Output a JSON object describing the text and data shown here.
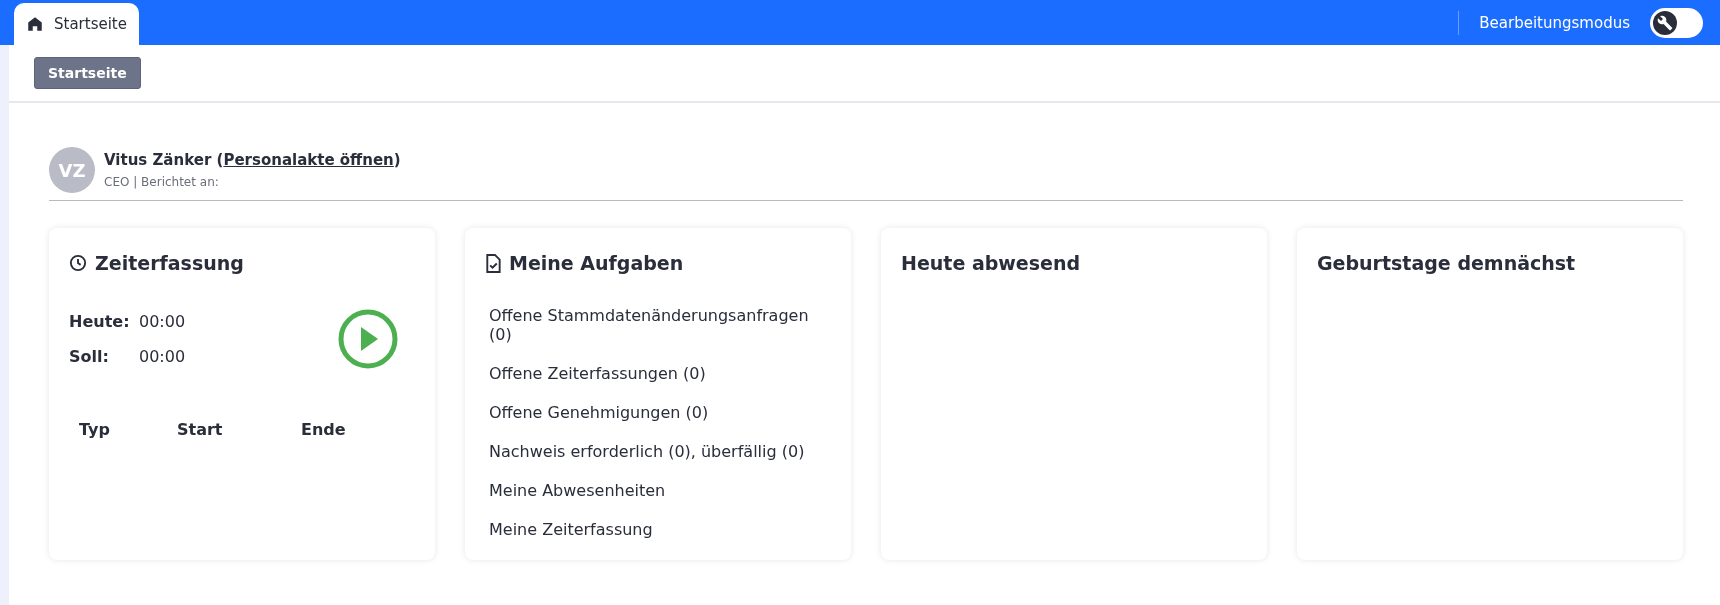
{
  "top_bar": {
    "tab": {
      "label": "Startseite",
      "selected": true
    },
    "edit_mode": {
      "label": "Bearbeitungsmodus",
      "on": false
    }
  },
  "breadcrumb": {
    "button": "Startseite"
  },
  "profile": {
    "initials": "VZ",
    "name": "Vitus Zänker",
    "link_open": "(",
    "link": "Personalakte öffnen",
    "link_close": ")",
    "subtitle": "CEO | Berichtet an:"
  },
  "cards": [
    {
      "kind": "time",
      "title": "Zeiterfassung",
      "rows": [
        {
          "label": "Heute:",
          "value": "00:00"
        },
        {
          "label": "Soll:",
          "value": "00:00"
        }
      ],
      "columns": [
        "Typ",
        "Start",
        "Ende"
      ]
    },
    {
      "kind": "tasks",
      "title": "Meine Aufgaben",
      "items": [
        "Offene Stammdatenänderungsanfragen (0)",
        "Offene Zeiterfassungen (0)",
        "Offene Genehmigungen (0)",
        "Nachweis erforderlich (0), überfällig (0)",
        "Meine Abwesenheiten",
        "Meine Zeiterfassung"
      ]
    },
    {
      "kind": "plain",
      "title": "Heute abwesend"
    },
    {
      "kind": "plain",
      "title": "Geburtstage demnächst"
    }
  ]
}
